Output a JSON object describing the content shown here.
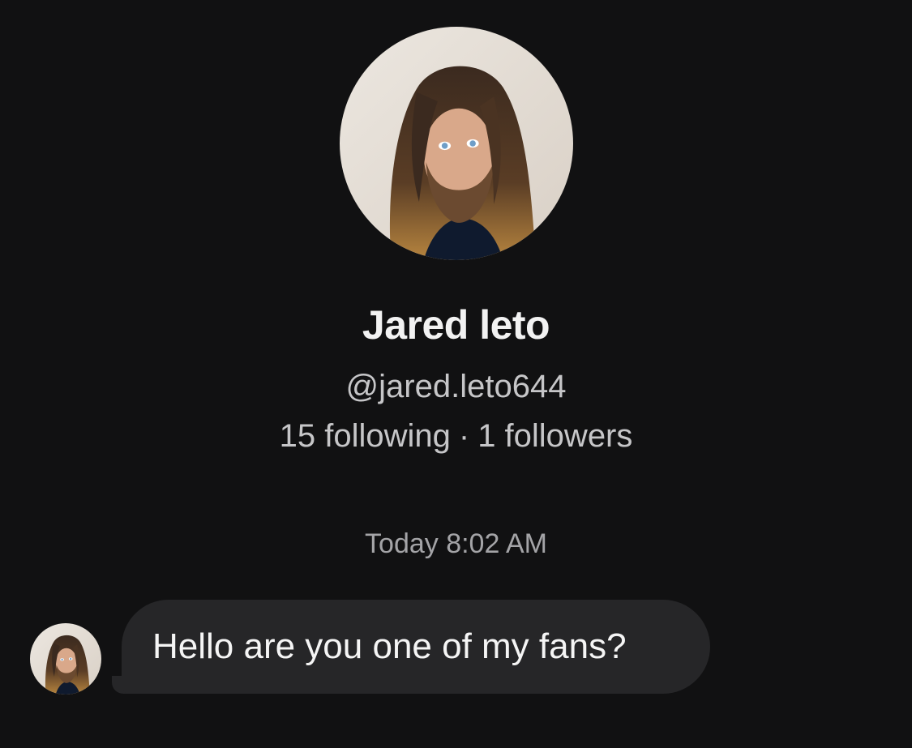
{
  "profile": {
    "name": "Jared leto",
    "handle": "@jared.leto644",
    "following": "15 following",
    "separator": "·",
    "followers": "1 followers",
    "avatar_icon": "profile-photo"
  },
  "conversation": {
    "timestamp": "Today 8:02 AM",
    "messages": [
      {
        "sender": "Jared leto",
        "text": "Hello are you one of my fans?",
        "avatar_icon": "sender-avatar"
      }
    ]
  },
  "colors": {
    "background": "#111112",
    "bubble": "#262628",
    "primary_text": "#f2f2f2",
    "secondary_text": "#c6c6c8",
    "timestamp_text": "#a4a4a7"
  }
}
